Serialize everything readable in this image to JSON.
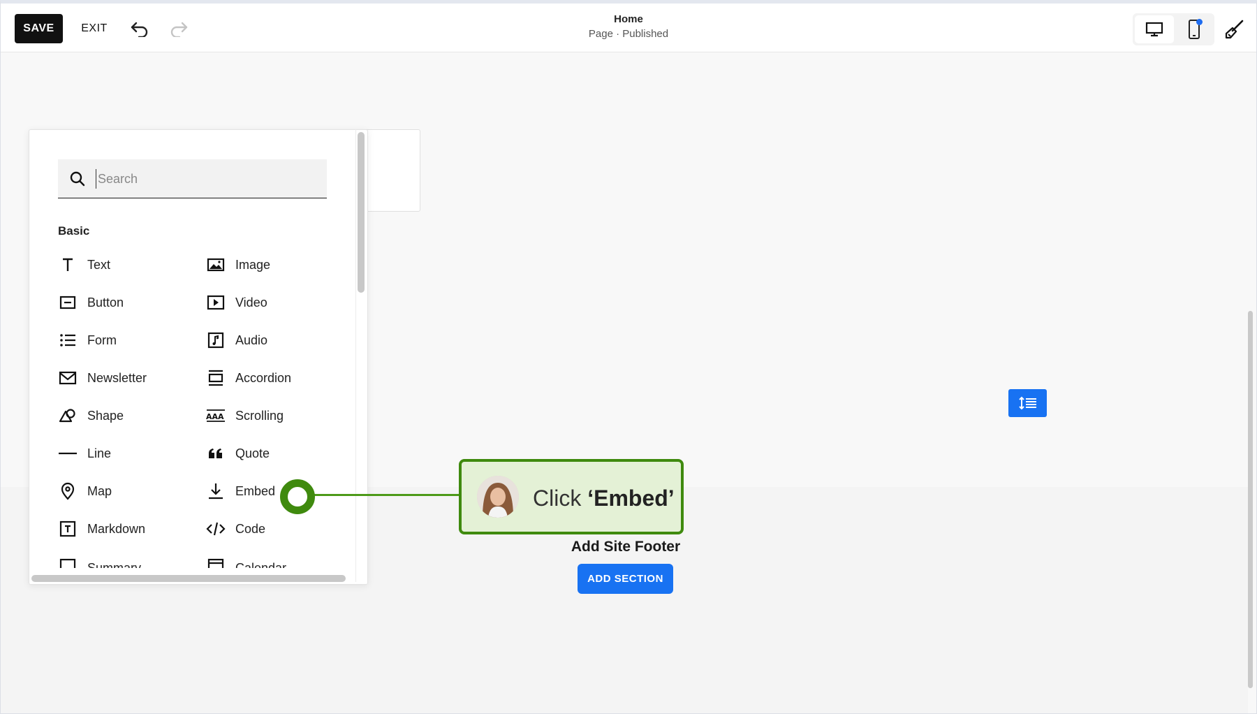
{
  "toolbar": {
    "save_label": "SAVE",
    "exit_label": "EXIT",
    "undo_icon": "undo-icon",
    "redo_icon": "redo-icon"
  },
  "page": {
    "title": "Home",
    "status": "Page · Published"
  },
  "device_switch": {
    "desktop_icon": "desktop-icon",
    "mobile_icon": "mobile-icon",
    "design_icon": "paintbrush-icon"
  },
  "block_panel": {
    "search_placeholder": "Search",
    "section_title": "Basic",
    "left_column": [
      {
        "label": "Text",
        "icon": "text-icon"
      },
      {
        "label": "Button",
        "icon": "button-icon"
      },
      {
        "label": "Form",
        "icon": "form-icon"
      },
      {
        "label": "Newsletter",
        "icon": "newsletter-icon"
      },
      {
        "label": "Shape",
        "icon": "shape-icon"
      },
      {
        "label": "Line",
        "icon": "line-icon"
      },
      {
        "label": "Map",
        "icon": "map-icon"
      },
      {
        "label": "Markdown",
        "icon": "markdown-icon"
      },
      {
        "label": "Summary",
        "icon": "summary-icon"
      }
    ],
    "right_column": [
      {
        "label": "Image",
        "icon": "image-icon"
      },
      {
        "label": "Video",
        "icon": "video-icon"
      },
      {
        "label": "Audio",
        "icon": "audio-icon"
      },
      {
        "label": "Accordion",
        "icon": "accordion-icon"
      },
      {
        "label": "Scrolling",
        "icon": "scrolling-icon"
      },
      {
        "label": "Quote",
        "icon": "quote-icon"
      },
      {
        "label": "Embed",
        "icon": "embed-icon"
      },
      {
        "label": "Code",
        "icon": "code-icon"
      },
      {
        "label": "Calendar",
        "icon": "calendar-icon"
      }
    ]
  },
  "canvas": {
    "spacing_icon": "section-spacing-icon",
    "footer_title": "Add Site Footer",
    "add_section_label": "ADD SECTION"
  },
  "tutorial": {
    "prefix": "Click ",
    "target": "‘Embed’",
    "accent": "#3f8a0e",
    "background": "#e4f1d6"
  }
}
